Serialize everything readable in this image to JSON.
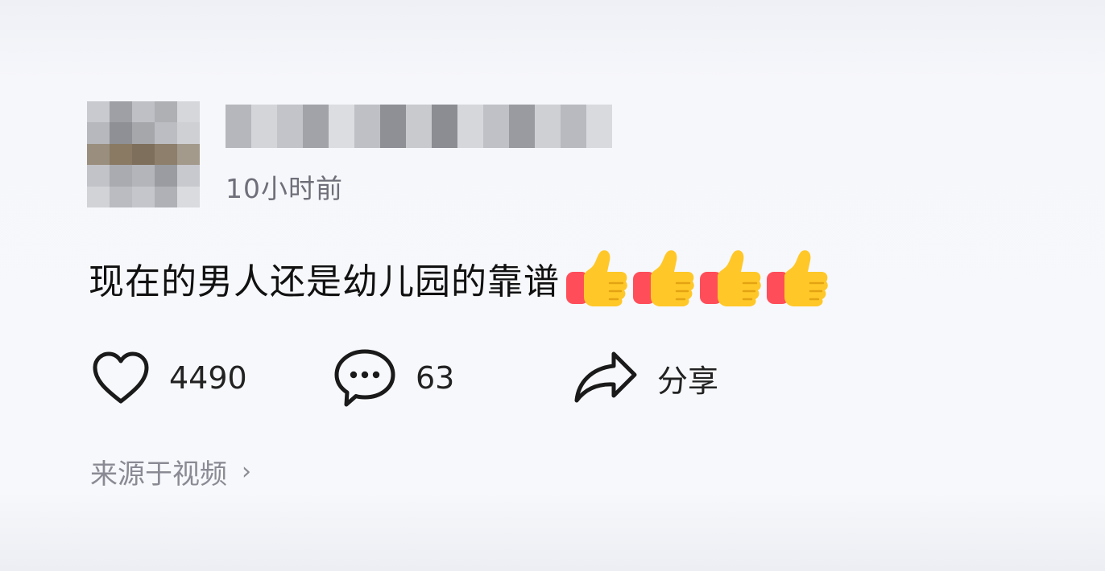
{
  "post": {
    "time": "10小时前",
    "content": "现在的男人还是幼儿园的靠谱",
    "emoji": [
      "thumbs-up",
      "thumbs-up",
      "thumbs-up",
      "thumbs-up"
    ]
  },
  "actions": {
    "like_count": "4490",
    "comment_count": "63",
    "share_label": "分享"
  },
  "source": {
    "label": "来源于视频",
    "chevron": "›"
  },
  "colors": {
    "thumb_yellow": "#ffc828",
    "thumb_sleeve": "#ff4e5a",
    "meta_text": "#6f6f7a",
    "source_text": "#8a8a94"
  }
}
